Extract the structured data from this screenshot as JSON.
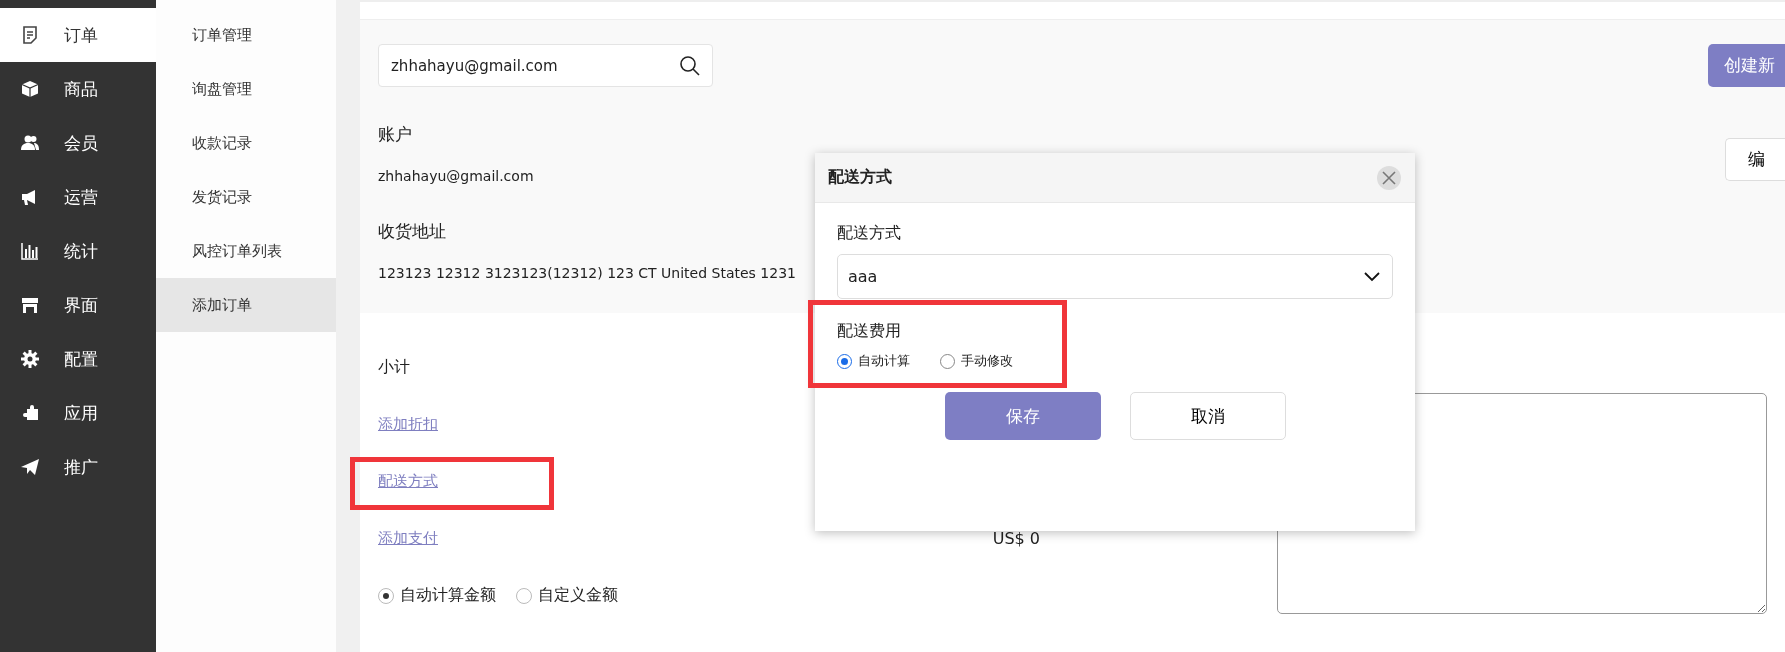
{
  "nav": {
    "items": [
      {
        "label": "订单",
        "selected": true
      },
      {
        "label": "商品",
        "selected": false
      },
      {
        "label": "会员",
        "selected": false
      },
      {
        "label": "运营",
        "selected": false
      },
      {
        "label": "统计",
        "selected": false
      },
      {
        "label": "界面",
        "selected": false
      },
      {
        "label": "配置",
        "selected": false
      },
      {
        "label": "应用",
        "selected": false
      },
      {
        "label": "推广",
        "selected": false
      }
    ]
  },
  "submenu": {
    "items": [
      {
        "label": "订单管理",
        "selected": false
      },
      {
        "label": "询盘管理",
        "selected": false
      },
      {
        "label": "收款记录",
        "selected": false
      },
      {
        "label": "发货记录",
        "selected": false
      },
      {
        "label": "风控订单列表",
        "selected": false
      },
      {
        "label": "添加订单",
        "selected": true
      }
    ]
  },
  "customer": {
    "search_value": "zhhahayu@gmail.com",
    "create_button": "创建新",
    "edit_button": "编",
    "account_heading": "账户",
    "account_email": "zhhahayu@gmail.com",
    "address_heading": "收货地址",
    "address": "123123 12312 3123123(12312) 123 CT United States 1231"
  },
  "summary": {
    "subtotal_label": "小计",
    "discount_link": "添加折扣",
    "shipping_link": "配送方式",
    "payment_link": "添加支付",
    "payment_amount": "US$ 0",
    "amount_modes": [
      {
        "label": "自动计算金额",
        "selected": true
      },
      {
        "label": "自定义金额",
        "selected": false
      }
    ]
  },
  "dialog": {
    "title": "配送方式",
    "method_label": "配送方式",
    "method_value": "aaa",
    "fee_label": "配送费用",
    "fee_modes": [
      {
        "label": "自动计算",
        "selected": true
      },
      {
        "label": "手动修改",
        "selected": false
      }
    ],
    "save_button": "保存",
    "cancel_button": "取消"
  }
}
